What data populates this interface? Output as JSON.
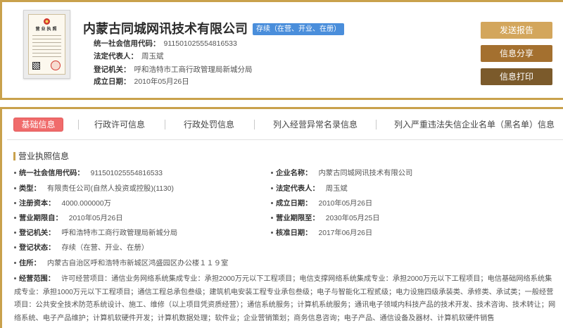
{
  "theme": {
    "gold": "#c9a14c",
    "active_tab": "#f06b6b",
    "badge_blue": "#4a8edb",
    "btn_report": "#d3a65c",
    "btn_share": "#a4702f",
    "btn_print": "#7b5a2b"
  },
  "license_thumbnail": {
    "title": "营业执照"
  },
  "header": {
    "company_name": "内蒙古同城网讯技术有限公司",
    "status": "存续（在营、开业、在册）",
    "rows": [
      {
        "label": "统一社会信用代码：",
        "value": "911501025554816533"
      },
      {
        "label": "法定代表人：",
        "value": "周玉斌"
      },
      {
        "label": "登记机关：",
        "value": "呼和浩特市工商行政管理局新城分局"
      },
      {
        "label": "成立日期：",
        "value": "2010年05月26日"
      }
    ]
  },
  "actions": [
    {
      "label": "发送报告"
    },
    {
      "label": "信息分享"
    },
    {
      "label": "信息打印"
    }
  ],
  "tabs": [
    {
      "label": "基础信息",
      "active": true
    },
    {
      "label": "行政许可信息",
      "active": false
    },
    {
      "label": "行政处罚信息",
      "active": false
    },
    {
      "label": "列入经营异常名录信息",
      "active": false
    },
    {
      "label": "列入严重违法失信企业名单（黑名单）信息",
      "active": false
    }
  ],
  "basic_info": {
    "section_title": "营业执照信息",
    "fields": [
      {
        "label": "统一社会信用代码：",
        "value": "911501025554816533"
      },
      {
        "label": "企业名称：",
        "value": "内蒙古同城网讯技术有限公司"
      },
      {
        "label": "类型：",
        "value": "有限责任公司(自然人投资或控股)(1130)"
      },
      {
        "label": "法定代表人：",
        "value": "周玉斌"
      },
      {
        "label": "注册资本：",
        "value": "4000.000000万"
      },
      {
        "label": "成立日期：",
        "value": "2010年05月26日"
      },
      {
        "label": "营业期限自：",
        "value": "2010年05月26日"
      },
      {
        "label": "营业期限至：",
        "value": "2030年05月25日"
      },
      {
        "label": "登记机关：",
        "value": "呼和浩特市工商行政管理局新城分局"
      },
      {
        "label": "核准日期：",
        "value": "2017年06月26日"
      },
      {
        "label": "登记状态：",
        "value": "存续（在营、开业、在册）"
      },
      {
        "label": "住所：",
        "value": "内蒙古自治区呼和浩特市新城区鸿盛园区办公楼１１９室"
      }
    ],
    "business_scope": {
      "label": "经营范围：",
      "value": "许可经营项目：通信业务网络系统集成专业：承担2000万元以下工程项目；电信支撑网络系统集成专业：承担2000万元以下工程项目；电信基础网络系统集成专业：承担1000万元以下工程项目；通信工程总承包叁级；建筑机电安装工程专业承包叁级；电子与智能化工程贰级；电力设施四级承装类、承修类、承试类；一般经营项目：公共安全技术防范系统设计、施工、维修（以上项目凭资质经营）；通信系统服务；计算机系统服务；通讯电子领域内科技产品的技术开发、技术咨询、技术转让；网络系统、电子产品维护；计算机软硬件开发；计算机数据处理；软件业；企业营销策划；商务信息咨询；电子产品、通信设备及器材、计算机软硬件销售"
    }
  }
}
